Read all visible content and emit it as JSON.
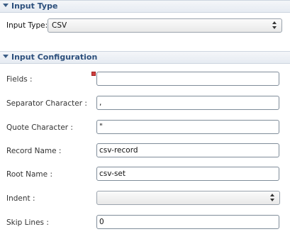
{
  "input_type_section": {
    "title": "Input Type",
    "input_type_label": "Input Type:",
    "input_type_value": "CSV"
  },
  "input_config_section": {
    "title": "Input Configuration",
    "fields_label": "Fields :",
    "fields_value": "",
    "separator_label": "Separator Character :",
    "separator_value": ",",
    "quote_label": "Quote Character :",
    "quote_value": "\"",
    "record_name_label": "Record Name :",
    "record_name_value": "csv-record",
    "root_name_label": "Root Name :",
    "root_name_value": "csv-set",
    "indent_label": "Indent :",
    "indent_value": "",
    "skip_lines_label": "Skip Lines :",
    "skip_lines_value": "0"
  }
}
